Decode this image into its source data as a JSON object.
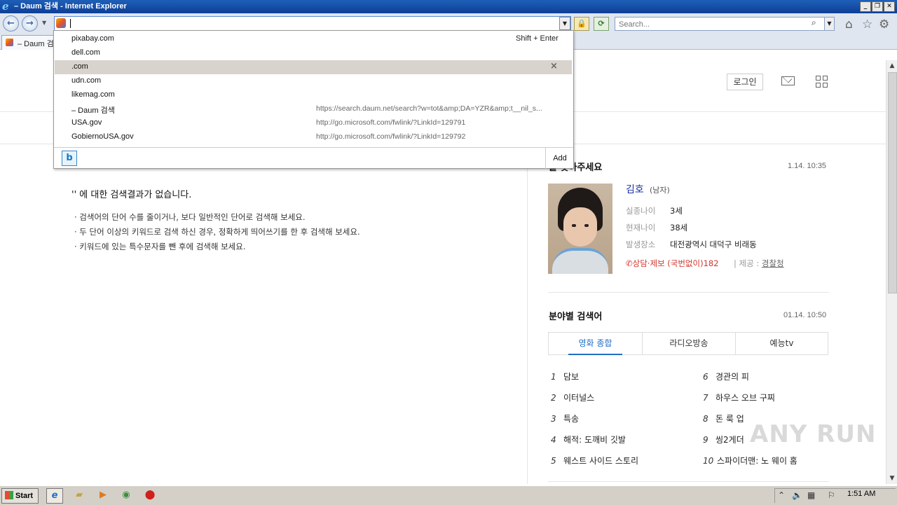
{
  "window": {
    "title": "– Daum 검색 - Internet Explorer"
  },
  "address_bar": {
    "value": ""
  },
  "search_box": {
    "placeholder": "Search..."
  },
  "tab": {
    "label": "– Daum 검"
  },
  "autocomplete": {
    "items": [
      {
        "text": "pixabay.com",
        "url": "",
        "hint": "Shift + Enter"
      },
      {
        "text": "dell.com",
        "url": ""
      },
      {
        "text": ".com",
        "url": "",
        "selected": true
      },
      {
        "text": "udn.com",
        "url": ""
      },
      {
        "text": "likemag.com",
        "url": ""
      },
      {
        "text": "– Daum 검색",
        "url": "https://search.daum.net/search?w=tot&amp;DA=YZR&amp;t__nil_s..."
      },
      {
        "text": "USA.gov",
        "url": "http://go.microsoft.com/fwlink/?LinkId=129791"
      },
      {
        "text": "GobiernoUSA.gov",
        "url": "http://go.microsoft.com/fwlink/?LinkId=129792"
      }
    ],
    "delete_glyph": "×",
    "add_label": "Add"
  },
  "header": {
    "login_label": "로그인"
  },
  "search_result": {
    "no_result": "'' 에 대한 검색결과가 없습니다.",
    "tips": [
      "· 검색어의 단어 수를 줄이거나, 보다 일반적인 단어로 검색해 보세요.",
      "· 두 단어 이상의 키워드로 검색 하신 경우, 정확하게 띄어쓰기를 한 후 검색해 보세요.",
      "· 키워드에 있는 특수문자를 뺀 후에 검색해 보세요."
    ]
  },
  "missing_child": {
    "title": "를 찾아주세요",
    "time": "1.14. 10:35",
    "name": "김호",
    "gender": "(남자)",
    "fields": [
      {
        "label": "실종나이",
        "value": "3세"
      },
      {
        "label": "현재나이",
        "value": "38세"
      },
      {
        "label": "발생장소",
        "value": "대전광역시 대덕구 비래동"
      }
    ],
    "phone": "상담·제보 (국번없이)182",
    "provider_label": "제공 : ",
    "provider": "경찰청"
  },
  "keywords": {
    "title": "분야별 검색어",
    "time": "01.14. 10:50",
    "tabs": [
      "영화 종합",
      "라디오방송",
      "예능tv"
    ],
    "active_tab": 0,
    "left": [
      {
        "rank": "1",
        "text": "담보"
      },
      {
        "rank": "2",
        "text": "이터널스"
      },
      {
        "rank": "3",
        "text": "특송"
      },
      {
        "rank": "4",
        "text": "해적: 도깨비 깃발"
      },
      {
        "rank": "5",
        "text": "웨스트 사이드 스토리"
      }
    ],
    "right": [
      {
        "rank": "6",
        "text": "경관의 피"
      },
      {
        "rank": "7",
        "text": "하우스 오브 구찌"
      },
      {
        "rank": "8",
        "text": "돈 룩 업"
      },
      {
        "rank": "9",
        "text": "씽2게더"
      },
      {
        "rank": "10",
        "text": "스파이더맨: 노 웨이 홈"
      }
    ]
  },
  "watermark": "ANY RUN",
  "taskbar": {
    "start_label": "Start",
    "clock": "1:51 AM"
  }
}
